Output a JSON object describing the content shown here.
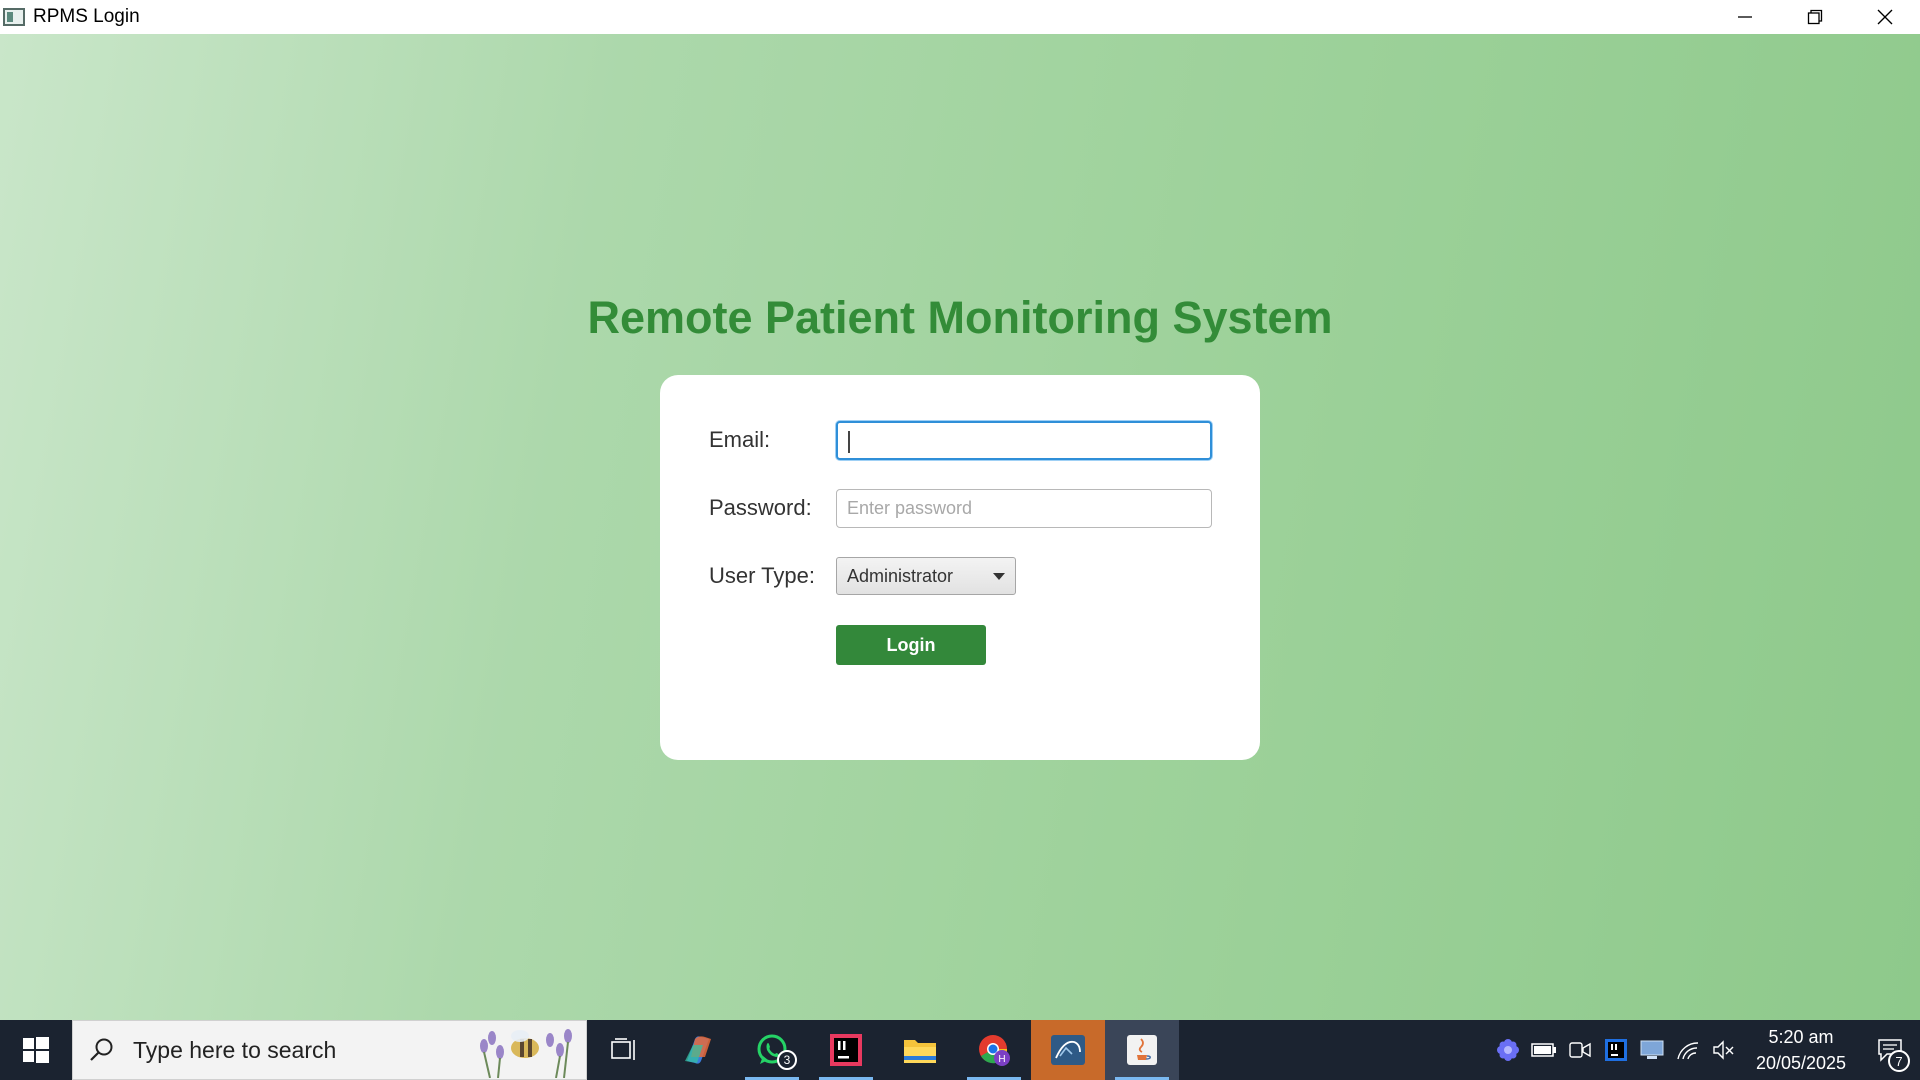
{
  "window": {
    "title": "RPMS Login",
    "controls": [
      "minimize",
      "restore",
      "close"
    ]
  },
  "form": {
    "heading": "Remote Patient Monitoring System",
    "email_label": "Email:",
    "email_value": "",
    "password_label": "Password:",
    "password_placeholder": "Enter password",
    "user_type_label": "User Type:",
    "user_type_selected": "Administrator",
    "login_label": "Login"
  },
  "taskbar": {
    "search_placeholder": "Type here to search",
    "whatsapp_badge": "3",
    "clock_time": "5:20 am",
    "clock_date": "20/05/2025",
    "notification_count": "7",
    "apps": [
      "task-view",
      "copilot",
      "whatsapp",
      "intellij",
      "file-explorer",
      "chrome",
      "mysql-workbench",
      "java"
    ]
  },
  "colors": {
    "heading": "#338c38",
    "login_button": "#33883a",
    "focus_border": "#2f8fd8",
    "taskbar": "#1b2330"
  }
}
